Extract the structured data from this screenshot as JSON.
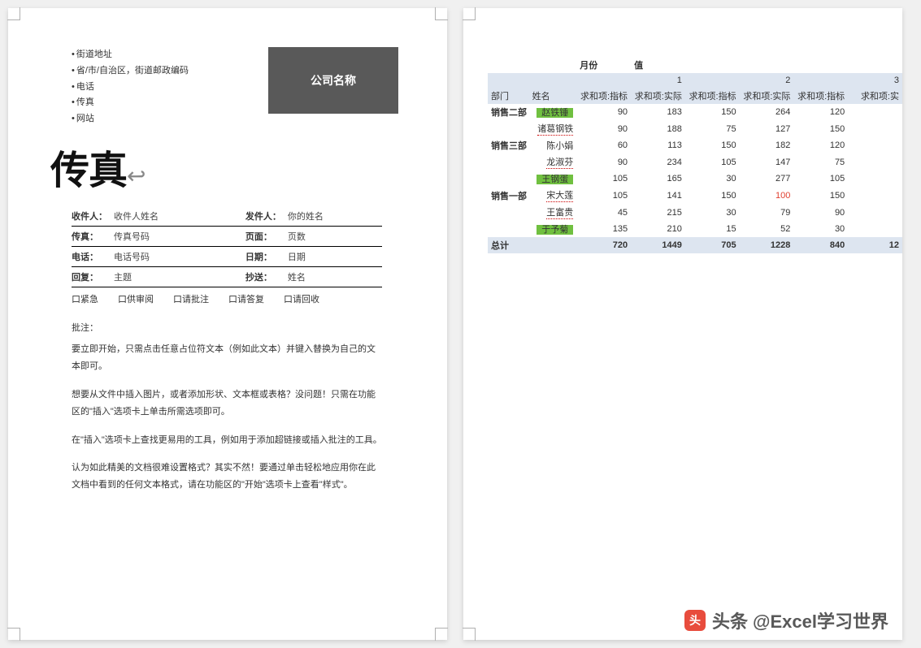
{
  "left_page": {
    "address": {
      "line1": "街道地址",
      "line2": "省/市/自治区，街道邮政编码",
      "line3": "电话",
      "line4": "传真",
      "line5": "网站"
    },
    "company_box": "公司名称",
    "title": "传真",
    "fields": {
      "recipient_lbl": "收件人：",
      "recipient_val": "收件人姓名",
      "sender_lbl": "发件人：",
      "sender_val": "你的姓名",
      "fax_lbl": "传真：",
      "fax_val": "传真号码",
      "pages_lbl": "页面：",
      "pages_val": "页数",
      "phone_lbl": "电话：",
      "phone_val": "电话号码",
      "date_lbl": "日期：",
      "date_val": "日期",
      "reply_lbl": "回复：",
      "reply_val": "主题",
      "cc_lbl": "抄送：",
      "cc_val": "姓名"
    },
    "checks": {
      "c1": "口紧急",
      "c2": "口供审阅",
      "c3": "口请批注",
      "c4": "口请答复",
      "c5": "口请回收"
    },
    "note_label": "批注：",
    "body": {
      "p1": "要立即开始，只需点击任意占位符文本（例如此文本）并键入替换为自己的文本即可。",
      "p2": "想要从文件中插入图片，或者添加形状、文本框或表格？没问题！只需在功能区的\"插入\"选项卡上单击所需选项即可。",
      "p3": "在\"插入\"选项卡上查找更易用的工具，例如用于添加超链接或插入批注的工具。",
      "p4": "认为如此精美的文档很难设置格式？其实不然！要通过单击轻松地应用你在此文档中看到的任何文本格式，请在功能区的\"开始\"选项卡上查看\"样式\"。"
    }
  },
  "right_page": {
    "header_labels": {
      "month": "月份",
      "value": "值",
      "dept": "部门",
      "name": "姓名",
      "m1": "1",
      "m2": "2",
      "m3": "3",
      "target": "求和项:指标",
      "actual": "求和项:实际",
      "actual_cut": "求和项:实"
    },
    "rows": [
      {
        "dept": "销售二部",
        "name": "赵铁锤",
        "hl": true,
        "v": [
          90,
          183,
          150,
          264,
          120,
          ""
        ]
      },
      {
        "dept": "",
        "name": "诸葛钢铁",
        "hl": false,
        "dotted": true,
        "v": [
          90,
          188,
          75,
          127,
          150,
          ""
        ]
      },
      {
        "dept": "销售三部",
        "name": "陈小娟",
        "hl": false,
        "v": [
          60,
          113,
          150,
          182,
          120,
          ""
        ]
      },
      {
        "dept": "",
        "name": "龙淑芬",
        "hl": false,
        "dotted": true,
        "v": [
          90,
          234,
          105,
          147,
          75,
          ""
        ]
      },
      {
        "dept": "",
        "name": "王钢蛋",
        "hl": true,
        "v": [
          105,
          165,
          30,
          277,
          105,
          ""
        ]
      },
      {
        "dept": "销售一部",
        "name": "宋大莲",
        "hl": false,
        "dotted": true,
        "red_index": 3,
        "v": [
          105,
          141,
          150,
          100,
          150,
          ""
        ]
      },
      {
        "dept": "",
        "name": "王富贵",
        "hl": false,
        "dotted": true,
        "v": [
          45,
          215,
          30,
          79,
          90,
          ""
        ]
      },
      {
        "dept": "",
        "name": "于予菊",
        "hl": true,
        "dotted": true,
        "v": [
          135,
          210,
          15,
          52,
          30,
          ""
        ]
      }
    ],
    "total": {
      "label": "总计",
      "v": [
        720,
        1449,
        705,
        1228,
        840,
        "12"
      ]
    }
  },
  "watermark": "头条 @Excel学习世界"
}
